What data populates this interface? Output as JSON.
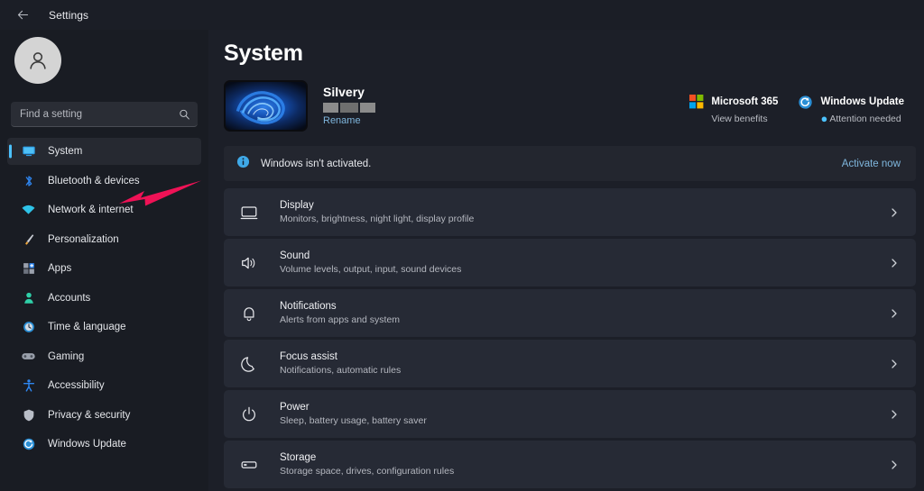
{
  "titlebar": {
    "back_icon": "back-arrow-icon",
    "title": "Settings"
  },
  "sidebar": {
    "avatar_icon": "user-avatar-icon",
    "search": {
      "placeholder": "Find a setting",
      "value": "",
      "icon": "search-icon"
    },
    "items": [
      {
        "label": "System",
        "icon": "monitor-icon",
        "selected": true
      },
      {
        "label": "Bluetooth & devices",
        "icon": "bluetooth-icon",
        "selected": false
      },
      {
        "label": "Network & internet",
        "icon": "wifi-icon",
        "selected": false
      },
      {
        "label": "Personalization",
        "icon": "paintbrush-icon",
        "selected": false
      },
      {
        "label": "Apps",
        "icon": "apps-grid-icon",
        "selected": false
      },
      {
        "label": "Accounts",
        "icon": "person-icon",
        "selected": false
      },
      {
        "label": "Time & language",
        "icon": "clock-icon",
        "selected": false
      },
      {
        "label": "Gaming",
        "icon": "gamepad-icon",
        "selected": false
      },
      {
        "label": "Accessibility",
        "icon": "accessibility-icon",
        "selected": false
      },
      {
        "label": "Privacy & security",
        "icon": "shield-icon",
        "selected": false
      },
      {
        "label": "Windows Update",
        "icon": "refresh-icon",
        "selected": false
      }
    ]
  },
  "main": {
    "page_title": "System",
    "device": {
      "thumbnail_icon": "windows-bloom-wallpaper",
      "name": "Silvery",
      "specs_redacted": true,
      "rename_label": "Rename"
    },
    "quicklinks": [
      {
        "icon": "microsoft-logo-icon",
        "title": "Microsoft 365",
        "subtitle": "View benefits",
        "has_status_dot": false
      },
      {
        "icon": "windows-update-refresh-icon",
        "title": "Windows Update",
        "subtitle": "Attention needed",
        "has_status_dot": true
      }
    ],
    "banner": {
      "icon": "info-icon",
      "text": "Windows isn't activated.",
      "action_label": "Activate now"
    },
    "cards": [
      {
        "icon": "display-monitor-icon",
        "title": "Display",
        "subtitle": "Monitors, brightness, night light, display profile",
        "chevron": "chevron-right-icon"
      },
      {
        "icon": "speaker-icon",
        "title": "Sound",
        "subtitle": "Volume levels, output, input, sound devices",
        "chevron": "chevron-right-icon"
      },
      {
        "icon": "bell-icon",
        "title": "Notifications",
        "subtitle": "Alerts from apps and system",
        "chevron": "chevron-right-icon"
      },
      {
        "icon": "moon-icon",
        "title": "Focus assist",
        "subtitle": "Notifications, automatic rules",
        "chevron": "chevron-right-icon"
      },
      {
        "icon": "power-icon",
        "title": "Power",
        "subtitle": "Sleep, battery usage, battery saver",
        "chevron": "chevron-right-icon"
      },
      {
        "icon": "drive-icon",
        "title": "Storage",
        "subtitle": "Storage space, drives, configuration rules",
        "chevron": "chevron-right-icon"
      }
    ]
  },
  "annotation": {
    "arrow_icon": "pink-pointer-arrow",
    "points_at": "Network & internet",
    "color": "#ef1256"
  },
  "colors": {
    "accent": "#4cc2ff",
    "page_bg": "#1c1f28",
    "sidebar_bg": "#191c23",
    "card_bg": "#262a35",
    "link": "#7fb6dd",
    "annotation": "#ef1256"
  }
}
